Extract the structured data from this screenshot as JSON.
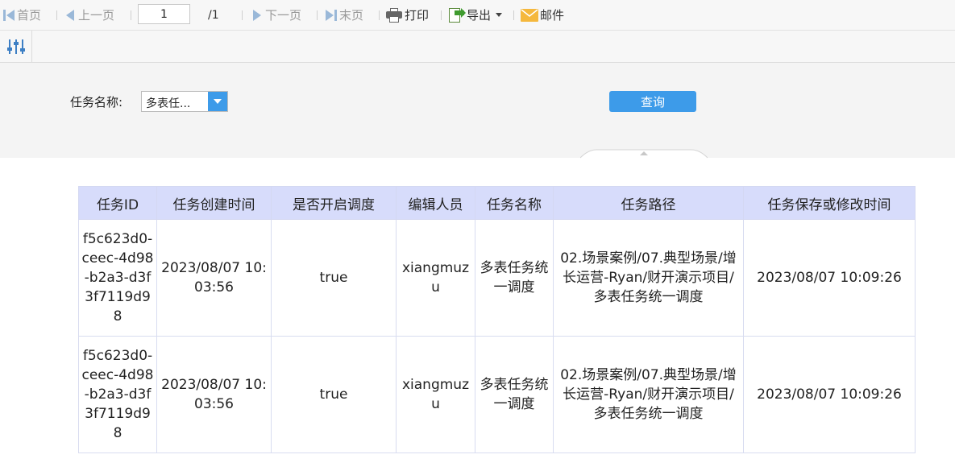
{
  "toolbar": {
    "first_label": "首页",
    "prev_label": "上一页",
    "page_value": "1",
    "total_label": "/1",
    "next_label": "下一页",
    "last_label": "末页",
    "print_label": "打印",
    "export_label": "导出",
    "mail_label": "邮件"
  },
  "query": {
    "task_name_label": "任务名称:",
    "task_name_value": "多表任...",
    "query_button": "查询"
  },
  "table": {
    "columns": [
      "任务ID",
      "任务创建时间",
      "是否开启调度",
      "编辑人员",
      "任务名称",
      "任务路径",
      "任务保存或修改时间"
    ],
    "rows": [
      [
        "f5c623d0-ceec-4d98-b2a3-d3f3f7119d98",
        "2023/08/07 10:03:56",
        "true",
        "xiangmuzu",
        "多表任务统一调度",
        "02.场景案例/07.典型场景/增长运营-Ryan/财开演示项目/多表任务统一调度",
        "2023/08/07 10:09:26"
      ],
      [
        "f5c623d0-ceec-4d98-b2a3-d3f3f7119d98",
        "2023/08/07 10:03:56",
        "true",
        "xiangmuzu",
        "多表任务统一调度",
        "02.场景案例/07.典型场景/增长运营-Ryan/财开演示项目/多表任务统一调度",
        "2023/08/07 10:09:26"
      ]
    ]
  },
  "colors": {
    "accent": "#3d9be9",
    "header_bg": "#d7dcfb",
    "toolbar_bg": "#f7f7f7"
  }
}
